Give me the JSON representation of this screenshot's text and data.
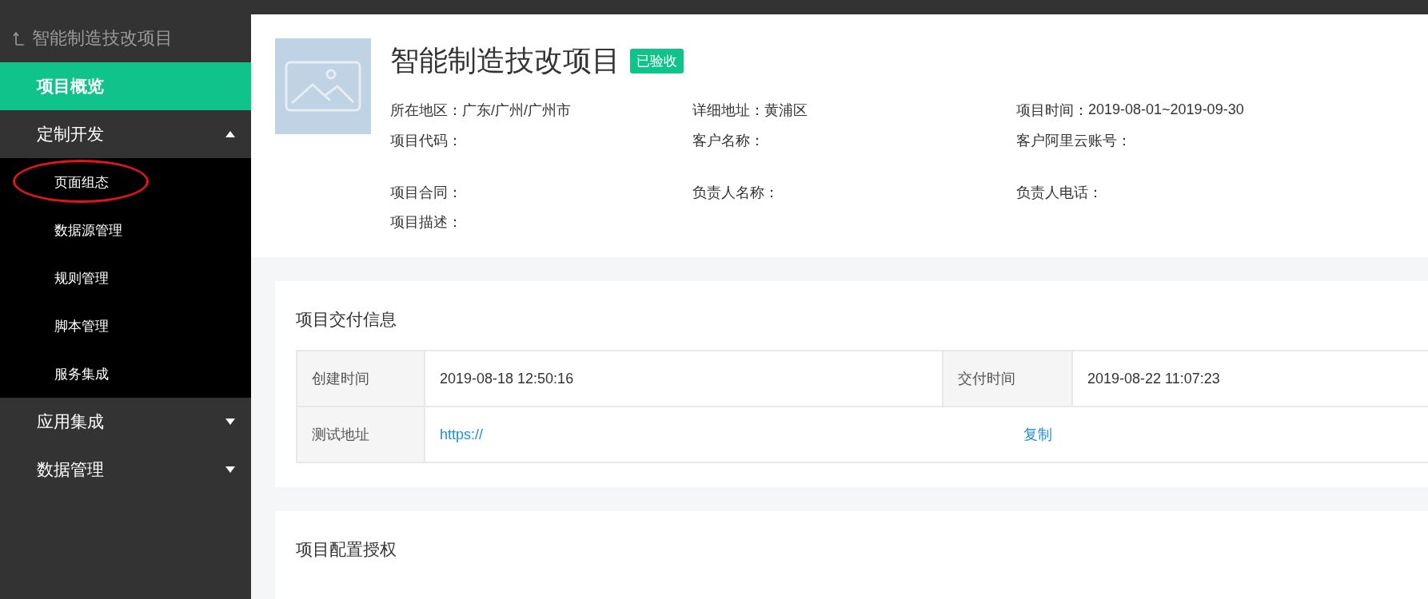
{
  "sidebar": {
    "back_title": "智能制造技改项目",
    "items": [
      {
        "label": "项目概览",
        "selected": true
      },
      {
        "label": "定制开发",
        "selected": false,
        "expanded": true,
        "children": [
          {
            "label": "页面组态",
            "selected": false,
            "circled": true
          },
          {
            "label": "数据源管理",
            "selected": false,
            "circled": false
          },
          {
            "label": "规则管理",
            "selected": false,
            "circled": false
          },
          {
            "label": "脚本管理",
            "selected": false,
            "circled": false
          },
          {
            "label": "服务集成",
            "selected": false,
            "circled": false
          }
        ]
      },
      {
        "label": "应用集成",
        "selected": false,
        "expanded": false
      },
      {
        "label": "数据管理",
        "selected": false,
        "expanded": false
      }
    ]
  },
  "project": {
    "title": "智能制造技改项目",
    "status": "已验收",
    "rows": [
      [
        {
          "label": "所在地区：",
          "value": "广东/广州/广州市"
        },
        {
          "label": "详细地址：",
          "value": "黄浦区"
        },
        {
          "label": "项目时间：",
          "value": "2019-08-01~2019-09-30"
        }
      ],
      [
        {
          "label": "项目代码："
        },
        {
          "label": "客户名称："
        },
        {
          "label": "客户阿里云账号："
        }
      ],
      [
        {
          "label": "项目合同："
        },
        {
          "label": "负责人名称："
        },
        {
          "label": "负责人电话："
        }
      ],
      [
        {
          "label": "项目描述："
        }
      ]
    ]
  },
  "delivery": {
    "title": "项目交付信息",
    "rows": [
      {
        "kind": "pair",
        "cells": [
          {
            "label": "创建时间",
            "value": "2019-08-18 12:50:16"
          },
          {
            "label": "交付时间",
            "value": "2019-08-22 11:07:23"
          }
        ]
      },
      {
        "kind": "link",
        "label": "测试地址",
        "link": "https://",
        "action": "复制"
      }
    ]
  },
  "config": {
    "title": "项目配置授权"
  }
}
